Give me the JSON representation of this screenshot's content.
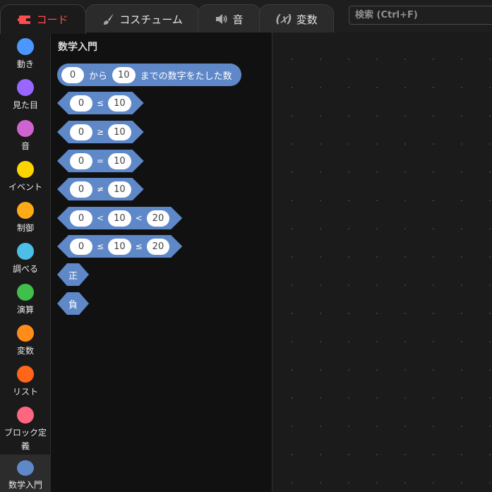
{
  "tabs": [
    {
      "label": "コード",
      "icon": "code-icon"
    },
    {
      "label": "コスチューム",
      "icon": "brush-icon"
    },
    {
      "label": "音",
      "icon": "speaker-icon"
    },
    {
      "label": "変数",
      "icon": "variable-icon"
    }
  ],
  "search": {
    "placeholder": "検索 (Ctrl+F)"
  },
  "categories": [
    {
      "label": "動き",
      "color": "#4c97ff"
    },
    {
      "label": "見た目",
      "color": "#9966ff"
    },
    {
      "label": "音",
      "color": "#cf63cf"
    },
    {
      "label": "イベント",
      "color": "#ffd500"
    },
    {
      "label": "制御",
      "color": "#ffab19"
    },
    {
      "label": "調べる",
      "color": "#4cbfe6"
    },
    {
      "label": "演算",
      "color": "#40bf4a"
    },
    {
      "label": "変数",
      "color": "#ff8c1a"
    },
    {
      "label": "リスト",
      "color": "#ff661a"
    },
    {
      "label": "ブロック定義",
      "color": "#ff6680"
    },
    {
      "label": "数学入門",
      "color": "#5f88c9"
    }
  ],
  "palette": {
    "title": "数学入門",
    "block_color": "#5f88c9",
    "blocks": {
      "sum": {
        "a": "0",
        "t1": "から",
        "b": "10",
        "t2": "までの数字をたした数"
      },
      "le": {
        "a": "0",
        "op": "≤",
        "b": "10"
      },
      "ge": {
        "a": "0",
        "op": "≥",
        "b": "10"
      },
      "eq": {
        "a": "0",
        "op": "=",
        "b": "10"
      },
      "ne": {
        "a": "0",
        "op": "≠",
        "b": "10"
      },
      "lt3": {
        "a": "0",
        "op1": "<",
        "b": "10",
        "op2": "<",
        "c": "20"
      },
      "le3": {
        "a": "0",
        "op1": "≤",
        "b": "10",
        "op2": "≤",
        "c": "20"
      },
      "pos": {
        "label": "正"
      },
      "neg": {
        "label": "負"
      }
    }
  }
}
